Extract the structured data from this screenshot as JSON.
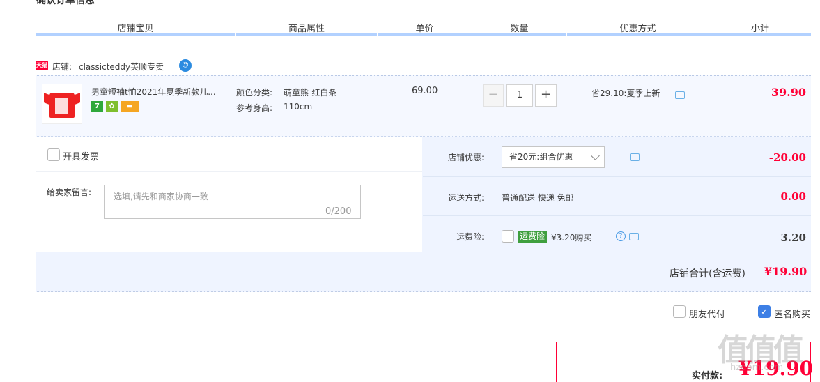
{
  "page": {
    "title": "确认订单信息"
  },
  "table_header": {
    "shop_item": "店铺宝贝",
    "attributes": "商品属性",
    "unit_price": "单价",
    "quantity": "数量",
    "discount": "优惠方式",
    "subtotal": "小计"
  },
  "shop": {
    "badge": "天猫",
    "label": "店铺:",
    "name": "classicteddy英顺专卖"
  },
  "item": {
    "title": "男童短袖t恤2021年夏季新款儿...",
    "icon_7": "7",
    "attr_color_label": "颜色分类:",
    "attr_color_value": "萌童熊-红白条",
    "attr_height_label": "参考身高:",
    "attr_height_value": "110cm",
    "unit_price": "69.00",
    "quantity_minus": "−",
    "quantity": "1",
    "quantity_plus": "+",
    "discount": "省29.10:夏季上新",
    "subtotal": "39.90"
  },
  "invoice": {
    "label": "开具发票"
  },
  "memo": {
    "label": "给卖家留言:",
    "placeholder": "选填,请先和商家协商一致",
    "count": "0/200"
  },
  "store_coupon": {
    "label": "店铺优惠:",
    "selected": "省20元:组合优惠",
    "amount": "-20.00"
  },
  "shipping": {
    "label": "运送方式:",
    "value": "普通配送 快递 免邮",
    "amount": "0.00"
  },
  "insurance": {
    "label": "运费险:",
    "badge": "运费险",
    "text": "¥3.20购买",
    "help": "?",
    "amount": "3.20"
  },
  "store_total": {
    "label": "店铺合计(含运费)",
    "value": "¥19.90"
  },
  "options": {
    "friend_pay": "朋友代付",
    "anonymous": "匿名购买",
    "anonymous_check": "✓"
  },
  "payment": {
    "label": "实付款:",
    "value": "¥19.90"
  },
  "watermark": {
    "logo": "值值值",
    "site": "hzdbm.com"
  },
  "colors": {
    "accent_red": "#ff0036",
    "header_line": "#b2d1ff",
    "row_bg": "#eff4ff"
  }
}
